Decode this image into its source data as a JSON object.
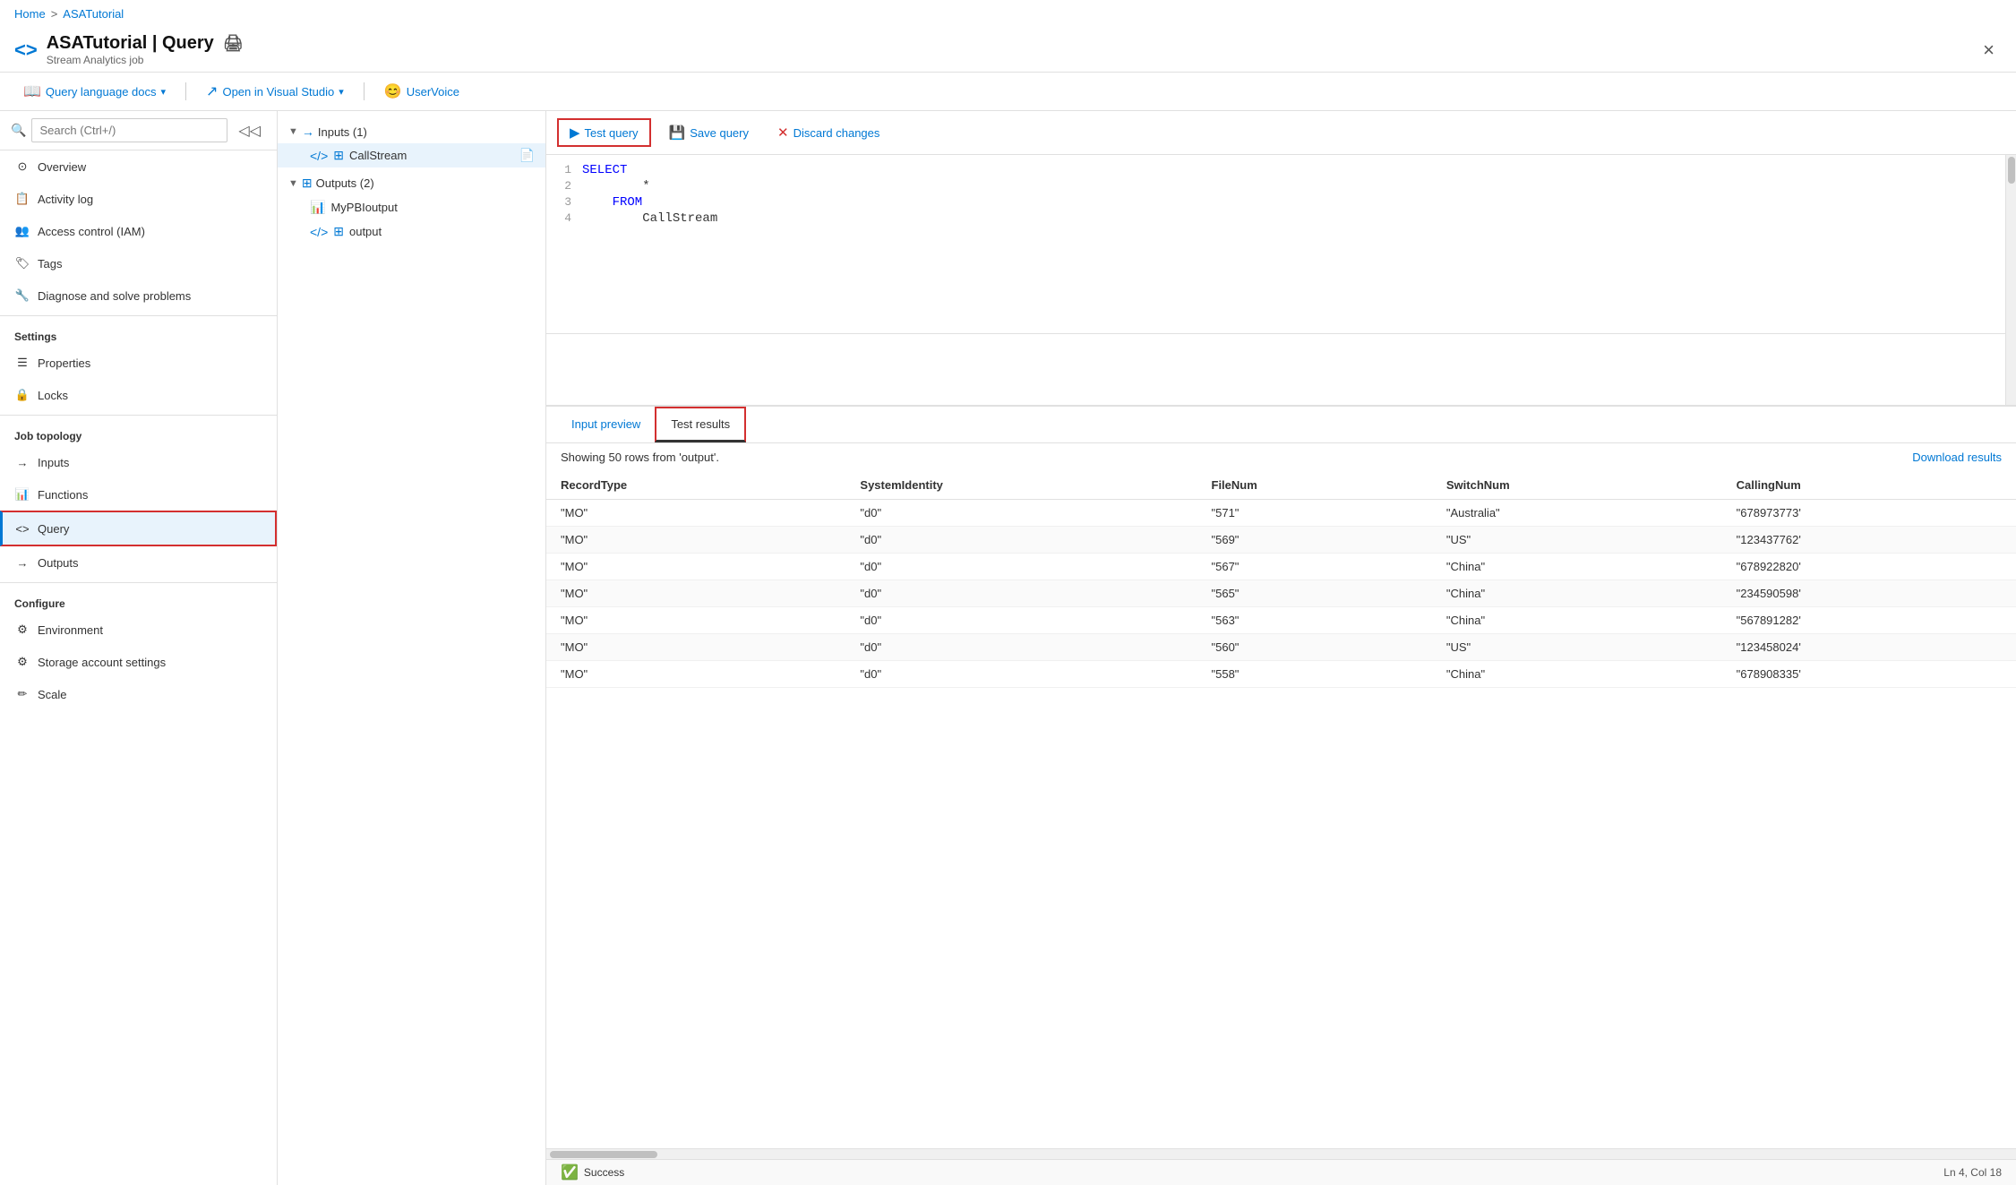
{
  "breadcrumb": {
    "home": "Home",
    "separator": ">",
    "current": "ASATutorial"
  },
  "header": {
    "icon": "<>",
    "title": "ASATutorial | Query",
    "subtitle": "Stream Analytics job",
    "print_label": "🖨",
    "close_label": "×"
  },
  "toolbar": {
    "items": [
      {
        "id": "query-lang-docs",
        "icon": "📖",
        "label": "Query language docs",
        "has_dropdown": true
      },
      {
        "id": "open-visual-studio",
        "icon": "↗",
        "label": "Open in Visual Studio",
        "has_dropdown": true
      },
      {
        "id": "user-voice",
        "icon": "😊",
        "label": "UserVoice",
        "has_dropdown": false
      }
    ]
  },
  "sidebar": {
    "search_placeholder": "Search (Ctrl+/)",
    "nav_items": [
      {
        "id": "overview",
        "icon": "⊙",
        "label": "Overview"
      },
      {
        "id": "activity-log",
        "icon": "📋",
        "label": "Activity log"
      },
      {
        "id": "access-control",
        "icon": "👥",
        "label": "Access control (IAM)"
      },
      {
        "id": "tags",
        "icon": "🏷",
        "label": "Tags"
      },
      {
        "id": "diagnose",
        "icon": "🔧",
        "label": "Diagnose and solve problems"
      }
    ],
    "settings_section": "Settings",
    "settings_items": [
      {
        "id": "properties",
        "icon": "☰",
        "label": "Properties"
      },
      {
        "id": "locks",
        "icon": "🔒",
        "label": "Locks"
      }
    ],
    "job_topology_section": "Job topology",
    "job_topology_items": [
      {
        "id": "inputs",
        "icon": "→",
        "label": "Inputs"
      },
      {
        "id": "functions",
        "icon": "📊",
        "label": "Functions"
      },
      {
        "id": "query",
        "icon": "<>",
        "label": "Query",
        "active": true
      },
      {
        "id": "outputs",
        "icon": "→",
        "label": "Outputs"
      }
    ],
    "configure_section": "Configure",
    "configure_items": [
      {
        "id": "environment",
        "icon": "⚙",
        "label": "Environment"
      },
      {
        "id": "storage-account-settings",
        "icon": "⚙",
        "label": "Storage account settings"
      },
      {
        "id": "scale",
        "icon": "✏",
        "label": "Scale"
      }
    ]
  },
  "tree": {
    "inputs_label": "Inputs (1)",
    "inputs_items": [
      {
        "id": "callstream",
        "label": "CallStream",
        "has_doc": true
      }
    ],
    "outputs_label": "Outputs (2)",
    "outputs_items": [
      {
        "id": "mypbIoutput",
        "label": "MyPBIoutput"
      },
      {
        "id": "output",
        "label": "output"
      }
    ]
  },
  "query_toolbar": {
    "test_query": "Test query",
    "save_query": "Save query",
    "discard_changes": "Discard changes"
  },
  "editor": {
    "lines": [
      {
        "num": "1",
        "content": "SELECT",
        "type": "keyword"
      },
      {
        "num": "2",
        "content": "        *",
        "type": "normal"
      },
      {
        "num": "3",
        "content": "    FROM",
        "type": "keyword"
      },
      {
        "num": "4",
        "content": "        CallStream",
        "type": "normal"
      }
    ]
  },
  "results": {
    "tab_input_preview": "Input preview",
    "tab_test_results": "Test results",
    "active_tab": "Test results",
    "showing_info": "Showing 50 rows from 'output'.",
    "download_label": "Download results",
    "columns": [
      "RecordType",
      "SystemIdentity",
      "FileNum",
      "SwitchNum",
      "CallingNum"
    ],
    "rows": [
      [
        "\"MO\"",
        "\"d0\"",
        "\"571\"",
        "\"Australia\"",
        "\"678973773'"
      ],
      [
        "\"MO\"",
        "\"d0\"",
        "\"569\"",
        "\"US\"",
        "\"123437762'"
      ],
      [
        "\"MO\"",
        "\"d0\"",
        "\"567\"",
        "\"China\"",
        "\"678922820'"
      ],
      [
        "\"MO\"",
        "\"d0\"",
        "\"565\"",
        "\"China\"",
        "\"234590598'"
      ],
      [
        "\"MO\"",
        "\"d0\"",
        "\"563\"",
        "\"China\"",
        "\"567891282'"
      ],
      [
        "\"MO\"",
        "\"d0\"",
        "\"560\"",
        "\"US\"",
        "\"123458024'"
      ],
      [
        "\"MO\"",
        "\"d0\"",
        "\"558\"",
        "\"China\"",
        "\"678908335'"
      ]
    ]
  },
  "status_bar": {
    "success_label": "Success",
    "cursor_position": "Ln 4, Col 18"
  }
}
